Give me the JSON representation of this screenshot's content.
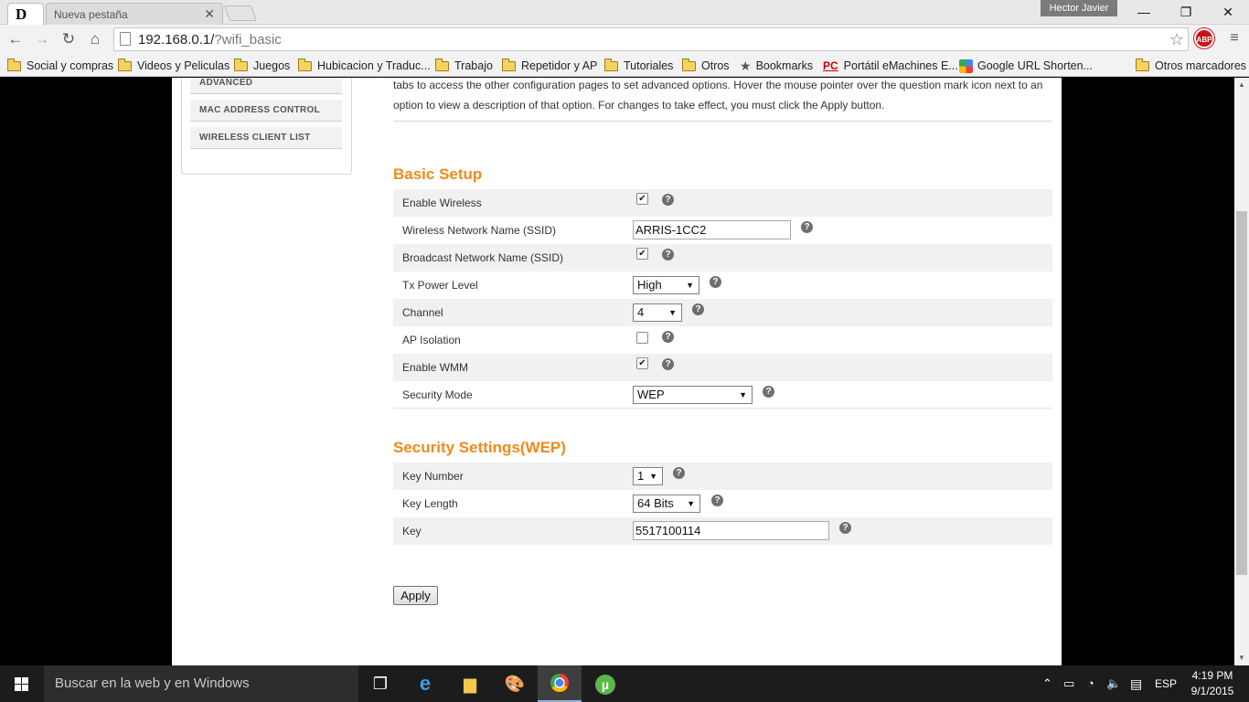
{
  "browser": {
    "tabs": [
      {
        "label": "",
        "icon": "d-favicon"
      },
      {
        "label": "Nueva pestaña"
      }
    ],
    "user": "Hector Javier",
    "url_host": "192.168.0.1/",
    "url_path": "?wifi_basic",
    "extension": "ABP"
  },
  "bookmarks": [
    "Social y compras",
    "Videos y Peliculas",
    "Juegos",
    "Hubicacion y Traduc...",
    "Trabajo",
    "Repetidor y AP",
    "Tutoriales",
    "Otros",
    "Bookmarks",
    "Portátil eMachines E...",
    "Google URL Shorten...",
    "Otros marcadores"
  ],
  "sidebar": {
    "items": [
      "ADVANCED",
      "MAC ADDRESS CONTROL",
      "WIRELESS CLIENT LIST"
    ]
  },
  "intro": "tabs to access the other configuration pages to set advanced options. Hover the mouse pointer over the question mark icon next to an option to view a description of that option. For changes to take effect, you must click the Apply button.",
  "basic_setup": {
    "title": "Basic Setup",
    "enable_wireless": {
      "label": "Enable Wireless",
      "checked": true
    },
    "ssid": {
      "label": "Wireless Network Name (SSID)",
      "value": "ARRIS-1CC2"
    },
    "broadcast_ssid": {
      "label": "Broadcast Network Name (SSID)",
      "checked": true
    },
    "tx_power": {
      "label": "Tx Power Level",
      "value": "High"
    },
    "channel": {
      "label": "Channel",
      "value": "4"
    },
    "ap_isolation": {
      "label": "AP Isolation",
      "checked": false
    },
    "enable_wmm": {
      "label": "Enable WMM",
      "checked": true
    },
    "security_mode": {
      "label": "Security Mode",
      "value": "WEP"
    }
  },
  "security": {
    "title": "Security Settings(WEP)",
    "key_number": {
      "label": "Key Number",
      "value": "1"
    },
    "key_length": {
      "label": "Key Length",
      "value": "64 Bits"
    },
    "key": {
      "label": "Key",
      "value": "5517100114"
    }
  },
  "apply_label": "Apply",
  "taskbar": {
    "search_placeholder": "Buscar en la web y en Windows",
    "language": "ESP",
    "time": "4:19 PM",
    "date": "9/1/2015"
  }
}
